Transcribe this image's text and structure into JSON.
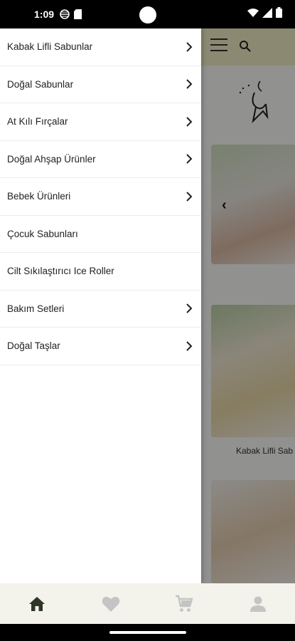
{
  "status_bar": {
    "time": "1:09"
  },
  "drawer": {
    "items": [
      {
        "label": "Kabak Lifli Sabunlar",
        "has_children": true
      },
      {
        "label": "Doğal Sabunlar",
        "has_children": true
      },
      {
        "label": "At Kılı Fırçalar",
        "has_children": true
      },
      {
        "label": "Doğal Ahşap Ürünler",
        "has_children": true
      },
      {
        "label": "Bebek Ürünleri",
        "has_children": true
      },
      {
        "label": "Çocuk Sabunları",
        "has_children": false
      },
      {
        "label": "Cilt Sıkılaştırıcı Ice Roller",
        "has_children": false
      },
      {
        "label": "Bakım Setleri",
        "has_children": true
      },
      {
        "label": "Doğal Taşlar",
        "has_children": true
      }
    ]
  },
  "background_page": {
    "product_caption": "Kabak Lifli Sab"
  },
  "bottom_nav": {
    "items": [
      {
        "icon": "home-icon",
        "active": true
      },
      {
        "icon": "heart-icon",
        "active": false
      },
      {
        "icon": "cart-icon",
        "active": false
      },
      {
        "icon": "account-icon",
        "active": false
      }
    ]
  },
  "colors": {
    "header_bg": "#f1ecc5",
    "nav_bg": "#f3f3ec",
    "nav_active": "#2c3526",
    "nav_inactive": "#c4c4c4"
  }
}
